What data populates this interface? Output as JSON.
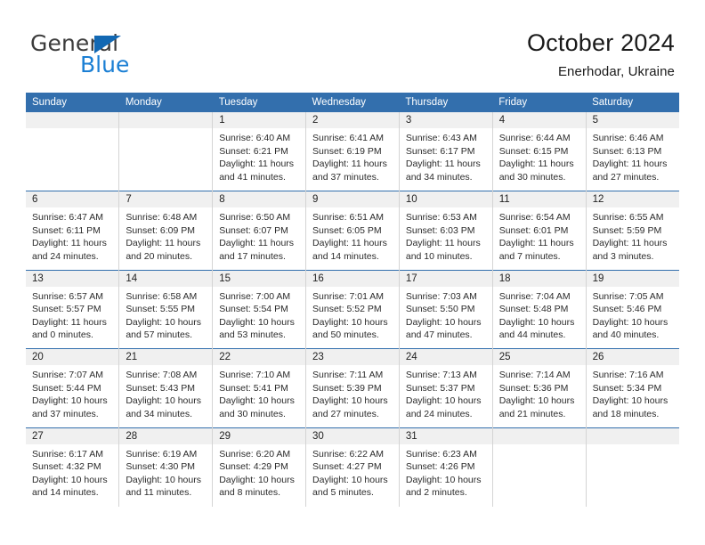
{
  "brand": {
    "name_top": "General",
    "name_bottom": "Blue",
    "triangle_color": "#1268b3",
    "blue_color": "#1b7fd4"
  },
  "header": {
    "title": "October 2024",
    "subtitle": "Enerhodar, Ukraine"
  },
  "theme": {
    "header_bg": "#336fad",
    "header_text": "#ffffff",
    "daynum_band_bg": "#f0f0f0",
    "row_separator": "#336fad",
    "cell_separator": "#d4d4d4"
  },
  "weekday_headers": [
    "Sunday",
    "Monday",
    "Tuesday",
    "Wednesday",
    "Thursday",
    "Friday",
    "Saturday"
  ],
  "labels": {
    "sunrise_prefix": "Sunrise: ",
    "sunset_prefix": "Sunset: ",
    "daylight_prefix": "Daylight: "
  },
  "weeks": [
    [
      {
        "day": "",
        "empty": true
      },
      {
        "day": "",
        "empty": true
      },
      {
        "day": "1",
        "sunrise": "Sunrise: 6:40 AM",
        "sunset": "Sunset: 6:21 PM",
        "daylight": "Daylight: 11 hours and 41 minutes."
      },
      {
        "day": "2",
        "sunrise": "Sunrise: 6:41 AM",
        "sunset": "Sunset: 6:19 PM",
        "daylight": "Daylight: 11 hours and 37 minutes."
      },
      {
        "day": "3",
        "sunrise": "Sunrise: 6:43 AM",
        "sunset": "Sunset: 6:17 PM",
        "daylight": "Daylight: 11 hours and 34 minutes."
      },
      {
        "day": "4",
        "sunrise": "Sunrise: 6:44 AM",
        "sunset": "Sunset: 6:15 PM",
        "daylight": "Daylight: 11 hours and 30 minutes."
      },
      {
        "day": "5",
        "sunrise": "Sunrise: 6:46 AM",
        "sunset": "Sunset: 6:13 PM",
        "daylight": "Daylight: 11 hours and 27 minutes."
      }
    ],
    [
      {
        "day": "6",
        "sunrise": "Sunrise: 6:47 AM",
        "sunset": "Sunset: 6:11 PM",
        "daylight": "Daylight: 11 hours and 24 minutes."
      },
      {
        "day": "7",
        "sunrise": "Sunrise: 6:48 AM",
        "sunset": "Sunset: 6:09 PM",
        "daylight": "Daylight: 11 hours and 20 minutes."
      },
      {
        "day": "8",
        "sunrise": "Sunrise: 6:50 AM",
        "sunset": "Sunset: 6:07 PM",
        "daylight": "Daylight: 11 hours and 17 minutes."
      },
      {
        "day": "9",
        "sunrise": "Sunrise: 6:51 AM",
        "sunset": "Sunset: 6:05 PM",
        "daylight": "Daylight: 11 hours and 14 minutes."
      },
      {
        "day": "10",
        "sunrise": "Sunrise: 6:53 AM",
        "sunset": "Sunset: 6:03 PM",
        "daylight": "Daylight: 11 hours and 10 minutes."
      },
      {
        "day": "11",
        "sunrise": "Sunrise: 6:54 AM",
        "sunset": "Sunset: 6:01 PM",
        "daylight": "Daylight: 11 hours and 7 minutes."
      },
      {
        "day": "12",
        "sunrise": "Sunrise: 6:55 AM",
        "sunset": "Sunset: 5:59 PM",
        "daylight": "Daylight: 11 hours and 3 minutes."
      }
    ],
    [
      {
        "day": "13",
        "sunrise": "Sunrise: 6:57 AM",
        "sunset": "Sunset: 5:57 PM",
        "daylight": "Daylight: 11 hours and 0 minutes."
      },
      {
        "day": "14",
        "sunrise": "Sunrise: 6:58 AM",
        "sunset": "Sunset: 5:55 PM",
        "daylight": "Daylight: 10 hours and 57 minutes."
      },
      {
        "day": "15",
        "sunrise": "Sunrise: 7:00 AM",
        "sunset": "Sunset: 5:54 PM",
        "daylight": "Daylight: 10 hours and 53 minutes."
      },
      {
        "day": "16",
        "sunrise": "Sunrise: 7:01 AM",
        "sunset": "Sunset: 5:52 PM",
        "daylight": "Daylight: 10 hours and 50 minutes."
      },
      {
        "day": "17",
        "sunrise": "Sunrise: 7:03 AM",
        "sunset": "Sunset: 5:50 PM",
        "daylight": "Daylight: 10 hours and 47 minutes."
      },
      {
        "day": "18",
        "sunrise": "Sunrise: 7:04 AM",
        "sunset": "Sunset: 5:48 PM",
        "daylight": "Daylight: 10 hours and 44 minutes."
      },
      {
        "day": "19",
        "sunrise": "Sunrise: 7:05 AM",
        "sunset": "Sunset: 5:46 PM",
        "daylight": "Daylight: 10 hours and 40 minutes."
      }
    ],
    [
      {
        "day": "20",
        "sunrise": "Sunrise: 7:07 AM",
        "sunset": "Sunset: 5:44 PM",
        "daylight": "Daylight: 10 hours and 37 minutes."
      },
      {
        "day": "21",
        "sunrise": "Sunrise: 7:08 AM",
        "sunset": "Sunset: 5:43 PM",
        "daylight": "Daylight: 10 hours and 34 minutes."
      },
      {
        "day": "22",
        "sunrise": "Sunrise: 7:10 AM",
        "sunset": "Sunset: 5:41 PM",
        "daylight": "Daylight: 10 hours and 30 minutes."
      },
      {
        "day": "23",
        "sunrise": "Sunrise: 7:11 AM",
        "sunset": "Sunset: 5:39 PM",
        "daylight": "Daylight: 10 hours and 27 minutes."
      },
      {
        "day": "24",
        "sunrise": "Sunrise: 7:13 AM",
        "sunset": "Sunset: 5:37 PM",
        "daylight": "Daylight: 10 hours and 24 minutes."
      },
      {
        "day": "25",
        "sunrise": "Sunrise: 7:14 AM",
        "sunset": "Sunset: 5:36 PM",
        "daylight": "Daylight: 10 hours and 21 minutes."
      },
      {
        "day": "26",
        "sunrise": "Sunrise: 7:16 AM",
        "sunset": "Sunset: 5:34 PM",
        "daylight": "Daylight: 10 hours and 18 minutes."
      }
    ],
    [
      {
        "day": "27",
        "sunrise": "Sunrise: 6:17 AM",
        "sunset": "Sunset: 4:32 PM",
        "daylight": "Daylight: 10 hours and 14 minutes."
      },
      {
        "day": "28",
        "sunrise": "Sunrise: 6:19 AM",
        "sunset": "Sunset: 4:30 PM",
        "daylight": "Daylight: 10 hours and 11 minutes."
      },
      {
        "day": "29",
        "sunrise": "Sunrise: 6:20 AM",
        "sunset": "Sunset: 4:29 PM",
        "daylight": "Daylight: 10 hours and 8 minutes."
      },
      {
        "day": "30",
        "sunrise": "Sunrise: 6:22 AM",
        "sunset": "Sunset: 4:27 PM",
        "daylight": "Daylight: 10 hours and 5 minutes."
      },
      {
        "day": "31",
        "sunrise": "Sunrise: 6:23 AM",
        "sunset": "Sunset: 4:26 PM",
        "daylight": "Daylight: 10 hours and 2 minutes."
      },
      {
        "day": "",
        "empty": true
      },
      {
        "day": "",
        "empty": true
      }
    ]
  ]
}
